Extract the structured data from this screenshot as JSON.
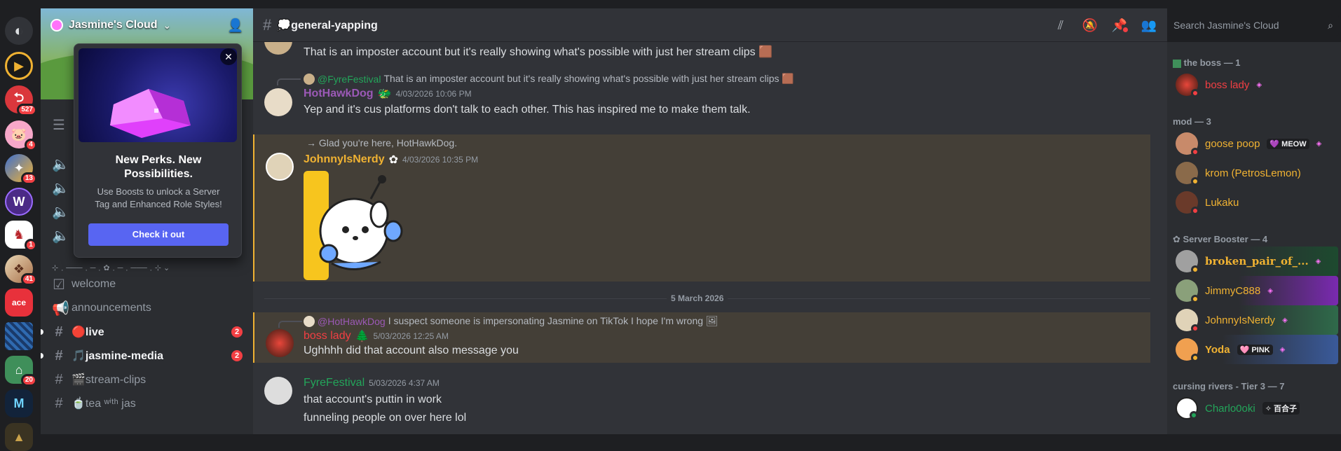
{
  "colors": {
    "accent": "#5865f2",
    "danger": "#f23f43",
    "highlight": "#f0b232",
    "online": "#23a55a",
    "idle": "#f0b232",
    "dnd": "#f23f43"
  },
  "servers": [
    {
      "name": "discord-home",
      "color": "#5865f2",
      "glyph": "◉",
      "badge": ""
    },
    {
      "name": "server-1",
      "color": "#f0b232",
      "glyph": "▶",
      "badge": ""
    },
    {
      "name": "server-2",
      "color": "#da373c",
      "glyph": "⮌",
      "badge": "527"
    },
    {
      "name": "server-3",
      "color": "#f47fb5",
      "glyph": "🐷",
      "badge": "4"
    },
    {
      "name": "server-4",
      "color": "#3c6fd1",
      "glyph": "✦",
      "badge": "13"
    },
    {
      "name": "server-5",
      "color": "#5b3c9b",
      "glyph": "W",
      "badge": ""
    },
    {
      "name": "server-6",
      "color": "#ffffff",
      "glyph": "♞",
      "badge": "1"
    },
    {
      "name": "server-7",
      "color": "#c7a27a",
      "glyph": "❖",
      "badge": "41"
    },
    {
      "name": "server-8",
      "color": "#e8313b",
      "glyph": "✂",
      "badge": ""
    },
    {
      "name": "server-9",
      "color": "#1a3a6a",
      "glyph": "▦",
      "badge": ""
    },
    {
      "name": "server-10",
      "color": "#3f8f5a",
      "glyph": "⌂",
      "badge": "20"
    },
    {
      "name": "server-11",
      "color": "#1c2e44",
      "glyph": "M",
      "badge": ""
    },
    {
      "name": "server-12",
      "color": "#caa24a",
      "glyph": "▲",
      "badge": ""
    }
  ],
  "server": {
    "name": "Jasmine's Cloud",
    "dropdown": "⌄",
    "invite_icon": "add-user"
  },
  "popup": {
    "title": "New Perks. New Possibilities.",
    "description": "Use Boosts to unlock a Server Tag and Enhanced Role Styles!",
    "cta": "Check it out",
    "close": "✕"
  },
  "channel_separator": "⊹﹒───﹒─﹒✿﹒─﹒───﹒⊹ ⌄",
  "channels": [
    {
      "icon": "☑",
      "label": "welcome",
      "unread": false,
      "badge": ""
    },
    {
      "icon": "📢",
      "label": "announcements",
      "unread": false,
      "badge": ""
    },
    {
      "icon": "#",
      "label": "🔴live",
      "unread": true,
      "badge": "2"
    },
    {
      "icon": "#",
      "label": "🎵jasmine-media",
      "unread": true,
      "badge": "2"
    },
    {
      "icon": "#",
      "label": "🎬stream-clips",
      "unread": false,
      "badge": ""
    },
    {
      "icon": "#",
      "label": "🍵tea ʷⁱᵗʰ jas",
      "unread": false,
      "badge": ""
    }
  ],
  "chat": {
    "channel": "💭general-yapping",
    "search_placeholder": "Search Jasmine's Cloud",
    "date_divider": "5 March 2026",
    "messages": [
      {
        "body": "That is an imposter account but it's really showing what's possible with just her stream clips 🟫"
      },
      {
        "reply_user": "@FyreFestival",
        "reply_text": "That is an imposter account but it's really showing what's possible with just her stream clips 🟫",
        "user": "HotHawkDog",
        "badge": "🐲",
        "time": "4/03/2026 10:06 PM",
        "body": "Yep and it's cus platforms don't talk to each other. This has inspired me to make them talk."
      },
      {
        "reply_text": "→ Glad you're here, HotHawkDog.",
        "user": "JohnnyIsNerdy",
        "badge": "✿",
        "time": "4/03/2026 10:35 PM",
        "body": ""
      },
      {
        "reply_user": "@HotHawkDog",
        "reply_text": "I suspect someone is impersonating Jasmine on TikTok I hope I'm wrong 🖼",
        "user": "boss lady",
        "badge": "🌲",
        "time": "5/03/2026 12:25 AM",
        "body": "Ughhhh did that account also message you"
      },
      {
        "user": "FyreFestival",
        "time": "5/03/2026 4:37 AM",
        "body": "that account's puttin in work",
        "body2": "funneling people on over here lol"
      }
    ]
  },
  "members": {
    "roles": [
      {
        "label": "the boss — 1"
      },
      {
        "label": "mod — 3"
      },
      {
        "label": "✿ Server Booster — 4"
      },
      {
        "label": "cursing rivers - Tier 3 — 7"
      }
    ],
    "list": [
      {
        "name": "boss lady",
        "color": "#f23f43",
        "tag": "",
        "boost": "◈",
        "status": "#f23f43"
      },
      {
        "name": "goose poop",
        "color": "#f0b232",
        "tag": "💜 MEOW",
        "boost": "◈",
        "status": "#f23f43"
      },
      {
        "name": "krom (PetrosLemon)",
        "color": "#f0b232",
        "tag": "",
        "boost": "",
        "status": "#f0b232"
      },
      {
        "name": "Lukaku",
        "color": "#f0b232",
        "tag": "",
        "boost": "",
        "status": "#f23f43"
      },
      {
        "name": "broken_pair_of_...",
        "color": "#f0b232",
        "tag": "",
        "boost": "◈",
        "status": "#f0b232"
      },
      {
        "name": "JimmyC888",
        "color": "#f0b232",
        "tag": "",
        "boost": "◈",
        "status": "#f0b232"
      },
      {
        "name": "JohnnyIsNerdy",
        "color": "#f0b232",
        "tag": "",
        "boost": "◈",
        "status": "#f23f43"
      },
      {
        "name": "Yoda",
        "color": "#f0b232",
        "tag": "🩷 PINK",
        "boost": "◈",
        "status": "#f0b232"
      },
      {
        "name": "Charlo0oki",
        "color": "#23a55a",
        "tag": "✧ 百合子",
        "boost": "",
        "status": "#23a55a"
      }
    ]
  }
}
